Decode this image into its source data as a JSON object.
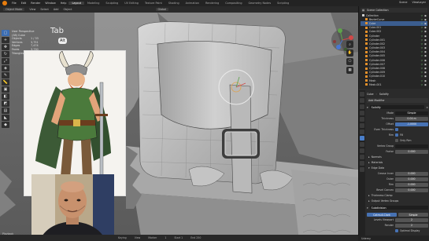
{
  "menubar": {
    "items": [
      "File",
      "Edit",
      "Render",
      "Window",
      "Help"
    ],
    "workspaces": [
      "Layout",
      "Modeling",
      "Sculpting",
      "UV Editing",
      "Texture Paint",
      "Shading",
      "Animation",
      "Rendering",
      "Compositing",
      "Geometry Nodes",
      "Scripting"
    ],
    "active_workspace": "Layout",
    "scene": "Scene",
    "view_layer": "ViewLayer"
  },
  "header": {
    "mode": "Object Mode",
    "items": [
      "View",
      "Select",
      "Add",
      "Object"
    ],
    "orientation": "Global"
  },
  "stats": {
    "view_title": "User Perspective",
    "collection": "(38) Cube",
    "rows": [
      {
        "k": "Objects",
        "v": "1 / 33"
      },
      {
        "k": "Vertices",
        "v": "3,751"
      },
      {
        "k": "Edges",
        "v": "7,474"
      },
      {
        "k": "Faces",
        "v": "3,730"
      },
      {
        "k": "Triangles",
        "v": "7,460"
      }
    ]
  },
  "overlay_hint": {
    "tab": "Tab",
    "alt": "Alt"
  },
  "outliner": {
    "title": "Scene Collection",
    "items": [
      {
        "name": "Collection",
        "collection": true,
        "selected": false
      },
      {
        "name": "BezierCurve",
        "collection": false,
        "selected": false
      },
      {
        "name": "Cube",
        "collection": false,
        "selected": true
      },
      {
        "name": "Cube.001",
        "collection": false,
        "selected": false
      },
      {
        "name": "Cube.002",
        "collection": false,
        "selected": false
      },
      {
        "name": "Cylinder",
        "collection": false,
        "selected": false
      },
      {
        "name": "Cylinder.001",
        "collection": false,
        "selected": false
      },
      {
        "name": "Cylinder.002",
        "collection": false,
        "selected": false
      },
      {
        "name": "Cylinder.003",
        "collection": false,
        "selected": false
      },
      {
        "name": "Cylinder.004",
        "collection": false,
        "selected": false
      },
      {
        "name": "Cylinder.005",
        "collection": false,
        "selected": false
      },
      {
        "name": "Cylinder.006",
        "collection": false,
        "selected": false
      },
      {
        "name": "Cylinder.007",
        "collection": false,
        "selected": false
      },
      {
        "name": "Cylinder.008",
        "collection": false,
        "selected": false
      },
      {
        "name": "Cylinder.009",
        "collection": false,
        "selected": false
      },
      {
        "name": "Cylinder.010",
        "collection": false,
        "selected": false
      },
      {
        "name": "Mesh",
        "collection": false,
        "selected": false
      },
      {
        "name": "Mesh.001",
        "collection": false,
        "selected": false
      }
    ]
  },
  "properties": {
    "object": "Cube",
    "modifier_type": "Solidify",
    "add_modifier": "Add Modifier",
    "modifier_name": "Solidify",
    "rows": [
      {
        "label": "Mode",
        "value": "Simple",
        "style": "dark"
      },
      {
        "label": "Thickness",
        "value": "0.04 m",
        "style": ""
      },
      {
        "label": "Offset",
        "value": "-1.0000",
        "style": "blue"
      },
      {
        "label": "Even Thickness",
        "value": "",
        "style": "check"
      },
      {
        "label": "Rim",
        "value": "Fill",
        "style": "check"
      },
      {
        "label": "",
        "value": "Only Rim",
        "style": "checkoff"
      },
      {
        "label": "Vertex Group",
        "value": "",
        "style": "dark"
      },
      {
        "label": "Factor",
        "value": "0.000",
        "style": ""
      }
    ],
    "subsections": [
      "Normals",
      "Materials",
      "Edge Data"
    ],
    "edge_rows": [
      {
        "label": "Crease Inner",
        "value": "0.000"
      },
      {
        "label": "Outer",
        "value": "0.000"
      },
      {
        "label": "Rim",
        "value": "0.000"
      },
      {
        "label": "Bevel Convex",
        "value": "0.000"
      }
    ],
    "subsections2": [
      "Thickness Clamp",
      "Output Vertex Groups"
    ],
    "sub2": {
      "label": "Subdivision",
      "rows": [
        {
          "label": "Levels Viewport",
          "value": "2"
        },
        {
          "label": "Render",
          "value": "2"
        }
      ]
    },
    "buttons": {
      "simple": "Catmull-Clark",
      "other": "Simple"
    },
    "optimal_display": "Optimal Display"
  },
  "timeline": {
    "items": [
      "Playback",
      "Keying",
      "View",
      "Marker"
    ],
    "frame": "1",
    "start": "Start 1",
    "end": "End 250"
  },
  "statusbar": {
    "udemy": "Udemy"
  },
  "colors": {
    "accent": "#4772b3",
    "orange": "#e8922b",
    "viewport": "#6b6b6b"
  }
}
